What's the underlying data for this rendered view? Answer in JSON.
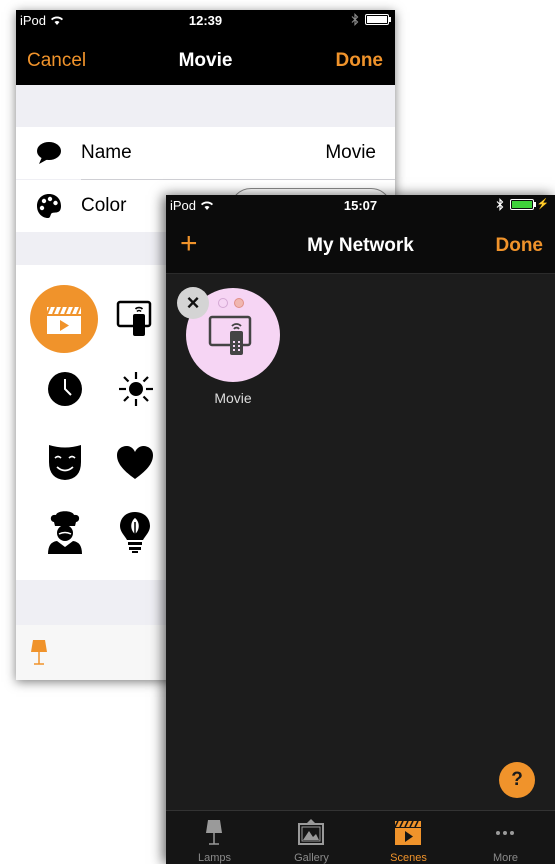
{
  "phone1": {
    "status": {
      "carrier": "iPod",
      "time": "12:39"
    },
    "nav": {
      "cancel": "Cancel",
      "title": "Movie",
      "done": "Done"
    },
    "rows": [
      {
        "label": "Name",
        "value": "Movie",
        "icon": "speech-bubble-icon"
      },
      {
        "label": "Color",
        "icon": "palette-icon"
      }
    ],
    "icons": [
      "clapperboard-icon",
      "tv-remote-icon",
      "clock-icon",
      "sun-icon",
      "theater-mask-icon",
      "heart-icon",
      "chef-icon",
      "light-bulb-icon"
    ],
    "selected_icon": "clapperboard-icon",
    "tab_icon": "lamp-icon"
  },
  "phone2": {
    "status": {
      "carrier": "iPod",
      "time": "15:07"
    },
    "nav": {
      "add": "+",
      "title": "My Network",
      "done": "Done"
    },
    "scene": {
      "label": "Movie",
      "icon": "tv-remote-icon",
      "color": "#f6d5f4"
    },
    "close_glyph": "×",
    "help_glyph": "?",
    "tabs": [
      {
        "label": "Lamps",
        "icon": "lamp-icon"
      },
      {
        "label": "Gallery",
        "icon": "gallery-icon"
      },
      {
        "label": "Scenes",
        "icon": "clapperboard-icon",
        "active": true
      },
      {
        "label": "More",
        "icon": "more-dots-icon"
      }
    ]
  },
  "colors": {
    "accent": "#f0932b",
    "dark_bg": "#1c1c1c",
    "scene_pink": "#f6d5f4"
  }
}
